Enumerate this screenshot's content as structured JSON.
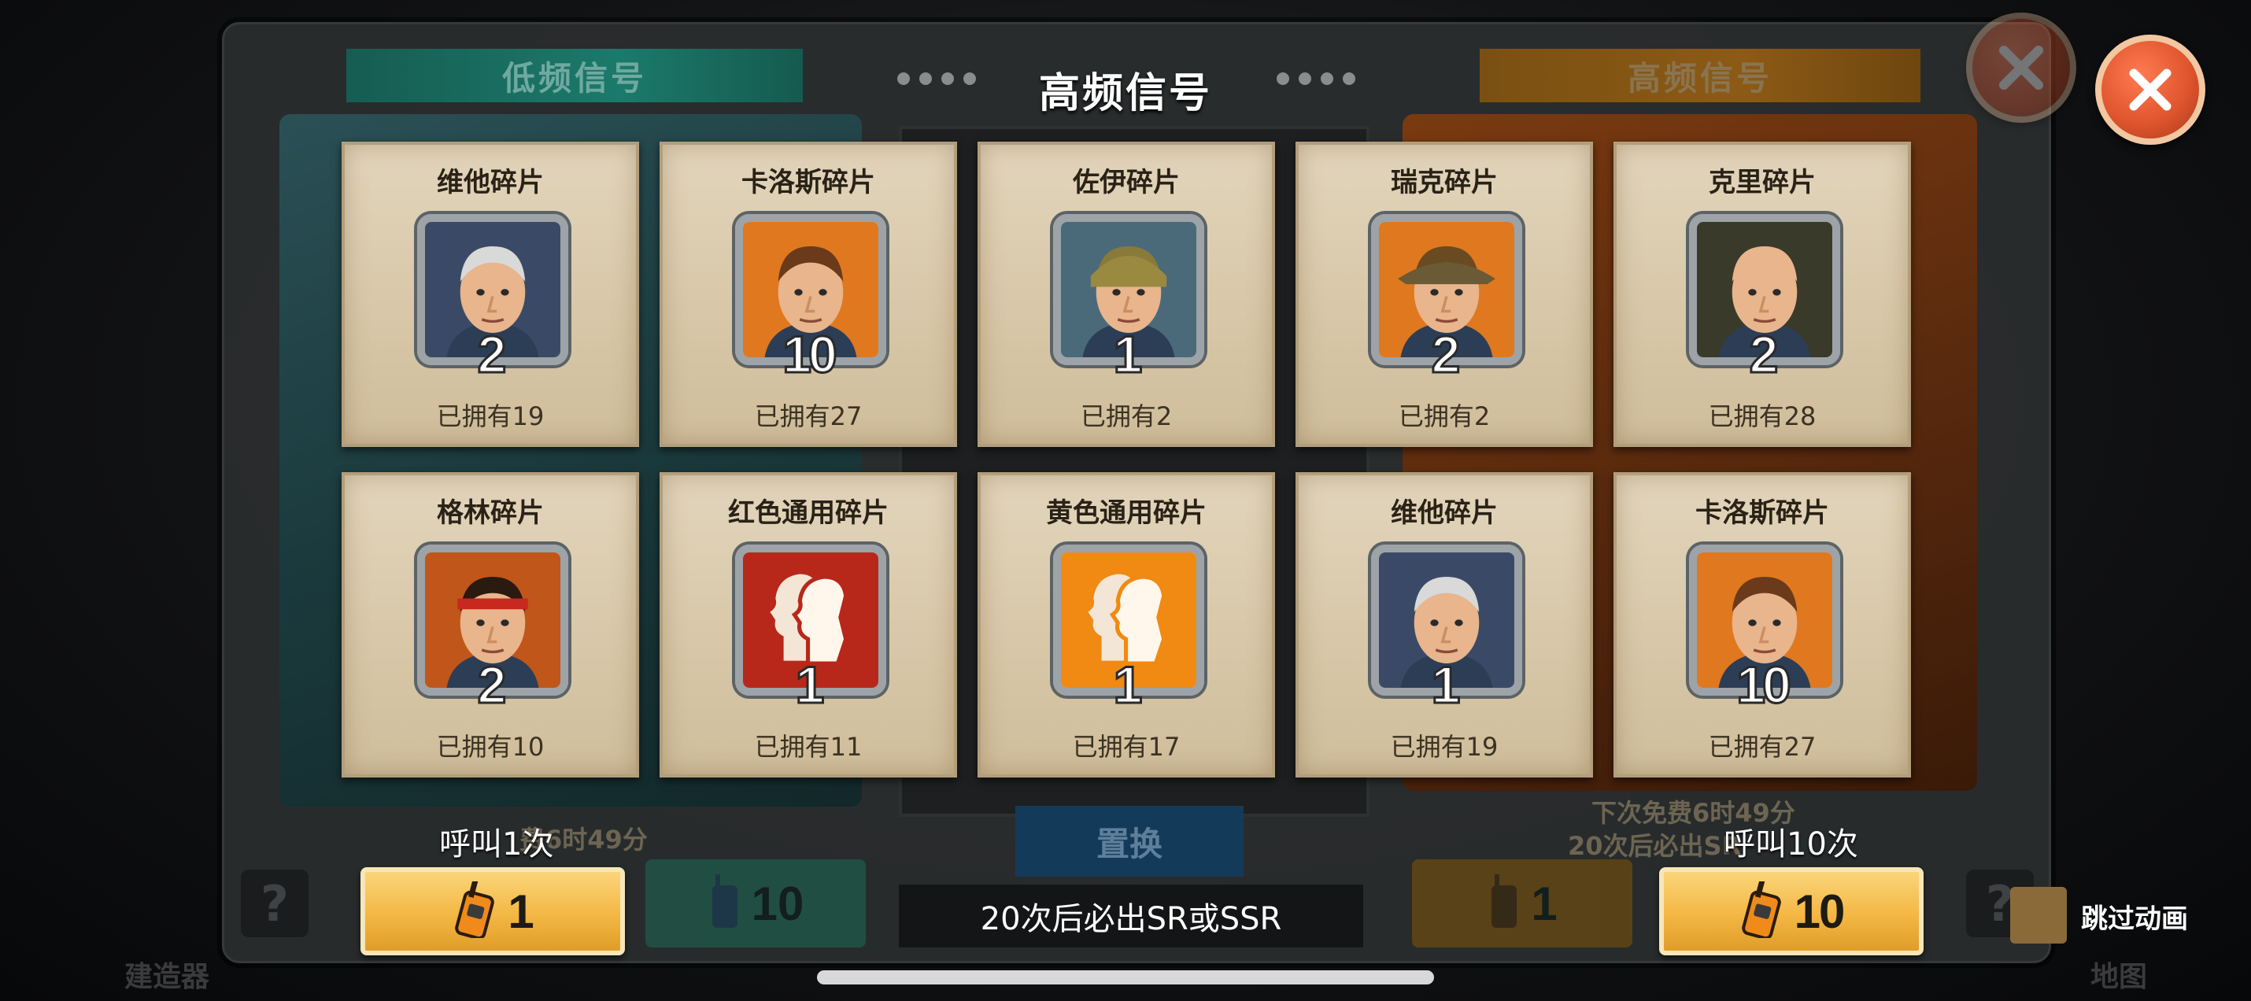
{
  "title": "高频信号",
  "background_tabs": {
    "left": "低频信号",
    "right": "高频信号",
    "replace": "置换",
    "left_timer": "费6时49分",
    "right_timer": "下次免费6时49分",
    "right_guarantee": "20次后必出SR",
    "left_dim_count": "10",
    "right_dim_count": "1",
    "builder": "建造器",
    "map": "地图"
  },
  "cards": [
    {
      "name": "维他碎片",
      "qty": "2",
      "owned": "已拥有19",
      "icon": "old-man-portrait-icon",
      "bg": "#3a4a66"
    },
    {
      "name": "卡洛斯碎片",
      "qty": "10",
      "owned": "已拥有27",
      "icon": "young-man-portrait-icon",
      "bg": "#e0781f"
    },
    {
      "name": "佐伊碎片",
      "qty": "1",
      "owned": "已拥有2",
      "icon": "helmet-soldier-portrait-icon",
      "bg": "#4a6a7a"
    },
    {
      "name": "瑞克碎片",
      "qty": "2",
      "owned": "已拥有2",
      "icon": "hat-soldier-portrait-icon",
      "bg": "#e0781f"
    },
    {
      "name": "克里碎片",
      "qty": "2",
      "owned": "已拥有28",
      "icon": "bald-man-portrait-icon",
      "bg": "#3a3a2a"
    },
    {
      "name": "格林碎片",
      "qty": "2",
      "owned": "已拥有10",
      "icon": "headband-man-portrait-icon",
      "bg": "#c0561a"
    },
    {
      "name": "红色通用碎片",
      "qty": "1",
      "owned": "已拥有11",
      "icon": "red-universal-shard-icon",
      "bg": "#b8281a"
    },
    {
      "name": "黄色通用碎片",
      "qty": "1",
      "owned": "已拥有17",
      "icon": "yellow-universal-shard-icon",
      "bg": "#f08a12"
    },
    {
      "name": "维他碎片",
      "qty": "1",
      "owned": "已拥有19",
      "icon": "old-man-portrait-icon",
      "bg": "#3a4a66"
    },
    {
      "name": "卡洛斯碎片",
      "qty": "10",
      "owned": "已拥有27",
      "icon": "young-man-portrait-icon",
      "bg": "#e0781f"
    }
  ],
  "call_once": {
    "label": "呼叫1次",
    "count": "1",
    "icon": "walkie-talkie-icon"
  },
  "call_ten": {
    "label": "呼叫10次",
    "count": "10",
    "icon": "walkie-talkie-icon"
  },
  "guarantee_note": "20次后必出SR或SSR",
  "skip_animation": "跳过动画",
  "colors": {
    "gold_button": "#f4b744",
    "close_button": "#e0562e",
    "card_bg": "#d9c9aa"
  }
}
